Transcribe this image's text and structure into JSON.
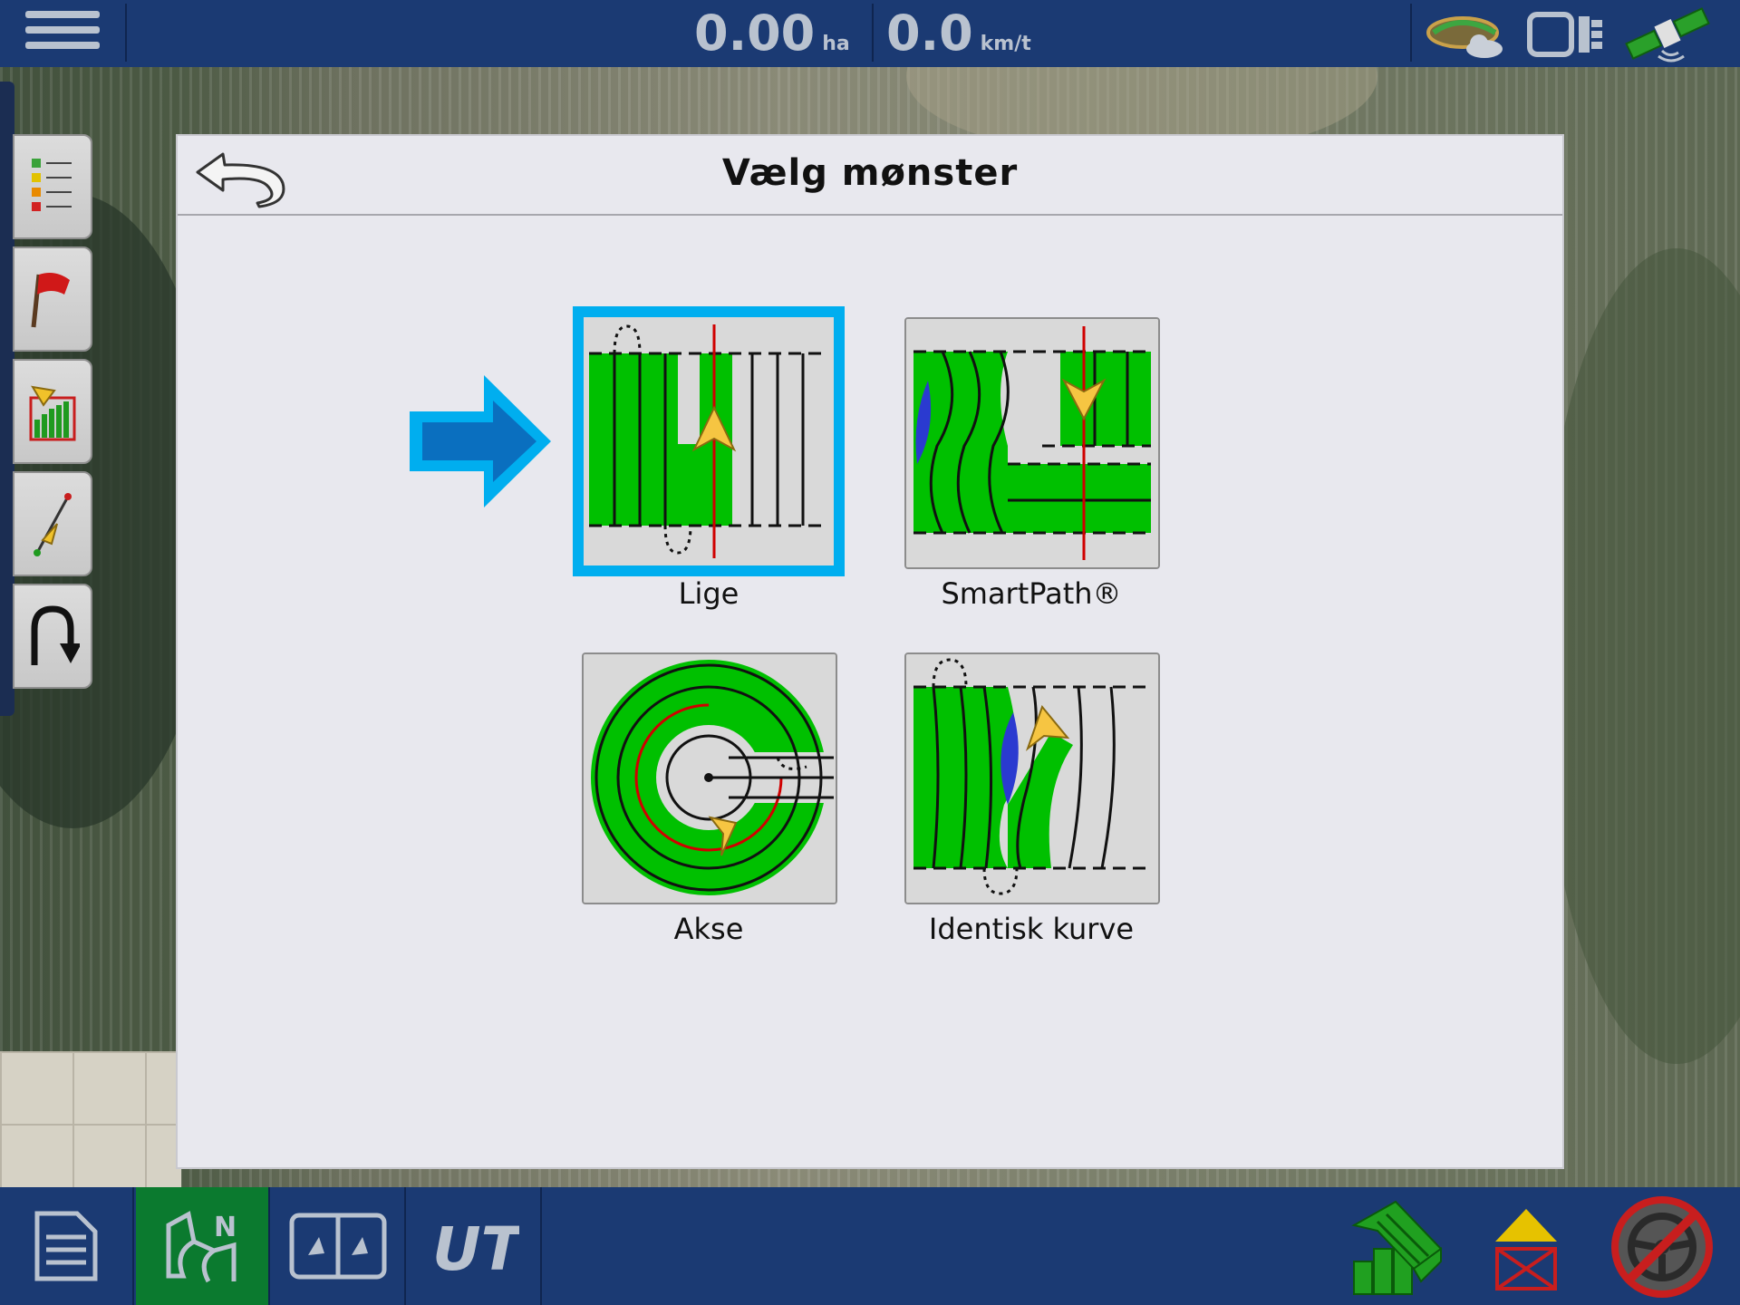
{
  "topbar": {
    "area_value": "0.00",
    "area_unit": "ha",
    "speed_value": "0.0",
    "speed_unit": "km/t",
    "icons": [
      "menu-icon",
      "field-cloud-icon",
      "display-device-icon",
      "gps-satellite-icon"
    ]
  },
  "left_toolbar": {
    "items": [
      "legend-list-icon",
      "flag-icon",
      "guidance-chart-icon",
      "ab-line-icon",
      "u-turn-icon"
    ]
  },
  "dialog": {
    "title": "Vælg mønster",
    "back_icon": "back-arrow-icon",
    "patterns": [
      {
        "label": "Lige",
        "selected": true,
        "icon": "straight-pattern-icon"
      },
      {
        "label": "SmartPath®",
        "selected": false,
        "icon": "smartpath-pattern-icon"
      },
      {
        "label": "Akse",
        "selected": false,
        "icon": "pivot-pattern-icon"
      },
      {
        "label": "Identisk kurve",
        "selected": false,
        "icon": "identical-curve-pattern-icon"
      }
    ],
    "pointer_icon": "pointer-arrow-icon"
  },
  "bottombar": {
    "tabs": [
      "document-icon",
      "field-map-icon",
      "split-view-icon",
      "ut-icon"
    ],
    "active_tab": "field-map-icon",
    "right_icons": [
      "section-control-icon",
      "implement-icon",
      "autosteer-disabled-icon"
    ]
  },
  "colors": {
    "bar_blue": "#1b3a73",
    "active_green": "#0b7a2f",
    "selection_cyan": "#00aeef",
    "coverage_green": "#00c000",
    "guide_red": "#d00000"
  }
}
